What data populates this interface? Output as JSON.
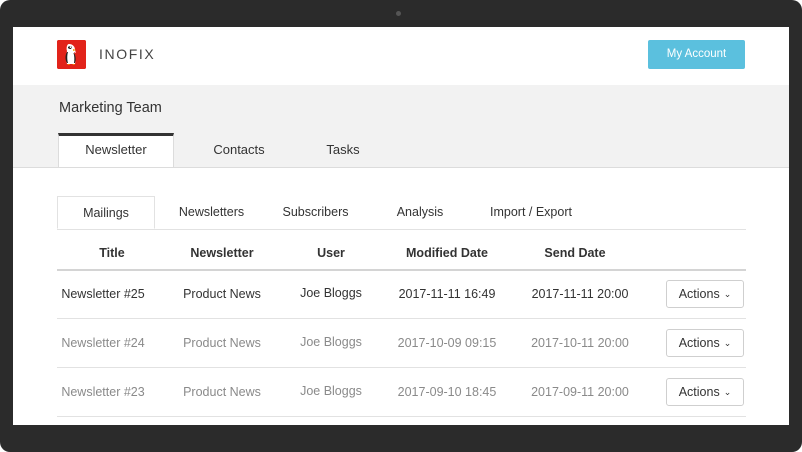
{
  "header": {
    "brand": "INOFIX",
    "account_button": "My Account"
  },
  "team": {
    "title": "Marketing Team",
    "tabs": [
      "Newsletter",
      "Contacts",
      "Tasks"
    ],
    "active_tab": "Newsletter"
  },
  "subtabs": {
    "items": [
      "Mailings",
      "Newsletters",
      "Subscribers",
      "Analysis",
      "Import / Export"
    ],
    "active": "Mailings"
  },
  "table": {
    "columns": [
      "Title",
      "Newsletter",
      "User",
      "Modified Date",
      "Send Date"
    ],
    "rows": [
      {
        "title": "Newsletter #25",
        "newsletter": "Product News",
        "user": "Joe Bloggs",
        "modified": "2017-11-11 16:49",
        "send": "2017-11-11 20:00",
        "action": "Actions"
      },
      {
        "title": "Newsletter #24",
        "newsletter": "Product News",
        "user": "Joe Bloggs",
        "modified": "2017-10-09 09:15",
        "send": "2017-10-11 20:00",
        "action": "Actions"
      },
      {
        "title": "Newsletter #23",
        "newsletter": "Product News",
        "user": "Joe Bloggs",
        "modified": "2017-09-10 18:45",
        "send": "2017-09-11 20:00",
        "action": "Actions"
      }
    ]
  },
  "colors": {
    "accent": "#5bc0de",
    "logo": "#e2231a",
    "bezel": "#2b2b2b",
    "band": "#f2f2f2"
  }
}
